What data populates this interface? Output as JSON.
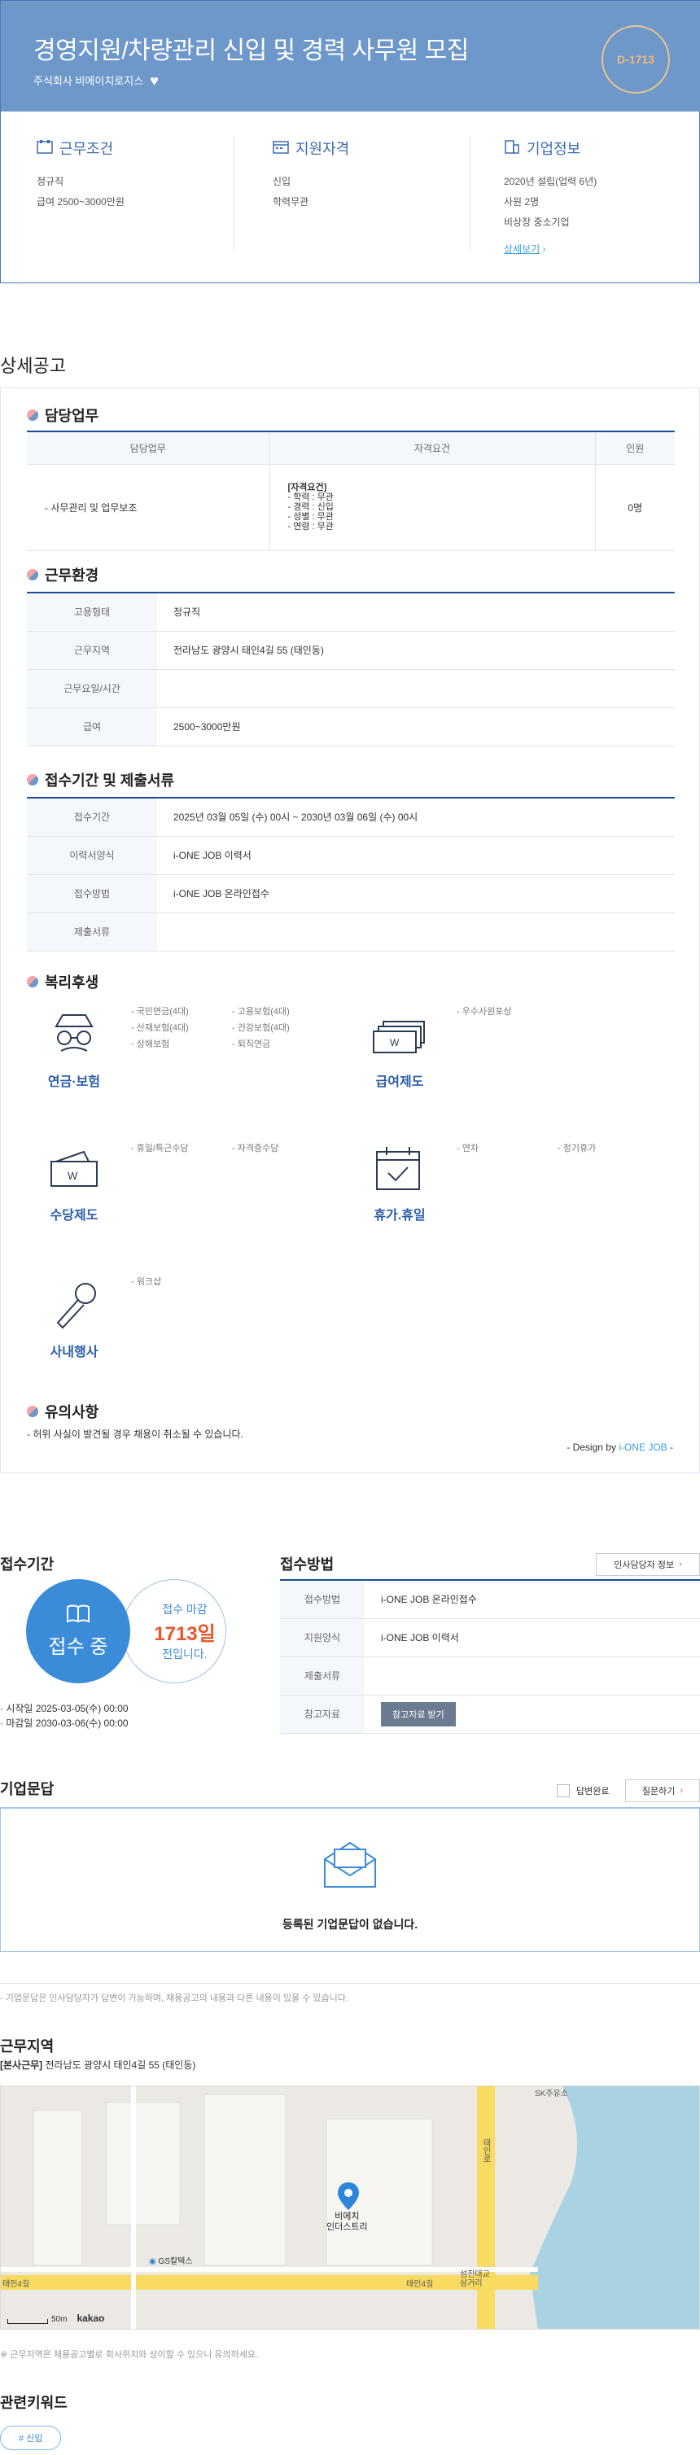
{
  "header": {
    "title": "경영지원/차량관리 신입 및 경력 사무원 모집",
    "company": "주식회사 비에이치로지스",
    "dday": "D-1713"
  },
  "summary": {
    "work": {
      "title": "근무조건",
      "type": "정규직",
      "salary": "급여 2500~3000만원"
    },
    "qual": {
      "title": "지원자격",
      "career": "신입",
      "education": "학력무관"
    },
    "company": {
      "title": "기업정보",
      "founded": "2020년 설립(업력 6년)",
      "employees": "사원 2명",
      "kind": "비상장 중소기업",
      "more": "상세보기"
    }
  },
  "detail": {
    "section_title": "상세공고",
    "duty": {
      "title": "담당업무",
      "headers": [
        "담당업무",
        "자격요건",
        "인원"
      ],
      "task": "- 사무관리 및 업무보조",
      "req_title": "[자격요건]",
      "req_lines": [
        "- 학력 : 무관",
        "- 경력 : 신입",
        "- 성별 : 무관",
        "- 연령 : 무관"
      ],
      "count": "0명"
    },
    "env": {
      "title": "근무환경",
      "rows": [
        {
          "k": "고용형태",
          "v": "정규직"
        },
        {
          "k": "근무지역",
          "v": "전라남도 광양시 태인4길 55 (태인동)"
        },
        {
          "k": "근무요일/시간",
          "v": ""
        },
        {
          "k": "급여",
          "v": "2500~3000만원"
        }
      ]
    },
    "apply": {
      "title": "접수기간 및 제출서류",
      "rows": [
        {
          "k": "접수기간",
          "v": "2025년 03월 05일 (수) 00시 ~ 2030년 03월 06일 (수) 00시"
        },
        {
          "k": "이력서양식",
          "v": "i-ONE JOB 이력서"
        },
        {
          "k": "접수방법",
          "v": "i-ONE JOB 온라인접수"
        },
        {
          "k": "제출서류",
          "v": ""
        }
      ]
    },
    "welfare": {
      "title": "복리후생",
      "groups": [
        {
          "label": "연금·보험",
          "items_a": [
            "- 국민연금(4대)",
            "- 산재보험(4대)",
            "- 상해보험"
          ],
          "items_b": [
            "- 고용보험(4대)",
            "- 건강보험(4대)",
            "- 퇴직연금"
          ]
        },
        {
          "label": "급여제도",
          "items_a": [
            "- 우수사원포상"
          ],
          "items_b": []
        },
        {
          "label": "수당제도",
          "items_a": [
            "- 휴일/특근수당"
          ],
          "items_b": [
            "- 자격증수당"
          ]
        },
        {
          "label": "휴가.휴일",
          "items_a": [
            "- 연차"
          ],
          "items_b": [
            "- 정기휴가"
          ]
        },
        {
          "label": "사내행사",
          "items_a": [
            "- 워크샵"
          ],
          "items_b": []
        }
      ]
    },
    "notice": {
      "title": "유의사항",
      "text": "- 허위 사실이 발견될 경우 채용이 취소될 수 있습니다.",
      "design_prefix": "- Design by",
      "design_brand": "i-ONE JOB",
      "design_suffix": " -"
    }
  },
  "period": {
    "title": "접수기간",
    "status": "접수 중",
    "deadline_label": "접수 마감",
    "deadline_days": "1713일",
    "deadline_suffix": "전입니다.",
    "start": "시작일 2025-03-05(수) 00:00",
    "end": "마감일 2030-03-06(수) 00:00"
  },
  "method": {
    "title": "접수방법",
    "contact_button": "인사담당자 정보",
    "rows": [
      {
        "k": "접수방법",
        "v": "i-ONE JOB 온라인접수"
      },
      {
        "k": "지원양식",
        "v": "i-ONE JOB 이력서"
      },
      {
        "k": "제출서류",
        "v": ""
      },
      {
        "k": "참고자료",
        "v": ""
      }
    ],
    "ref_button": "참고자료 받기"
  },
  "qna": {
    "title": "기업문답",
    "answered_label": "답변완료",
    "ask_button": "질문하기",
    "empty": "등록된 기업문답이 없습니다.",
    "note": "- 기업문답은 인사담당자가 답변이 가능하며, 채용공고의 내용과 다른 내용이 있을 수 있습니다."
  },
  "location": {
    "title": "근무지역",
    "tag": "[본사근무]",
    "address": "전라남도 광양시 태인4길 55 (태인동)",
    "map_marker": "비에치\n인더스트리",
    "map_labels": {
      "poi": "GS칼텍스",
      "road_left": "태인4길",
      "road_right": "태인4길",
      "junction": "섬진대교\n삼거리",
      "top": "SK주유소",
      "vertical_road": "태인로",
      "scale": "50m",
      "brand": "kakao"
    },
    "note": "※ 근무지역은 채용공고별로 회사위치와 상이할 수 있으니 유의하세요."
  },
  "keywords": {
    "title": "관련키워드",
    "items": [
      "# 신입"
    ]
  },
  "colors": {
    "primary": "#1b4d96",
    "banner": "#6e98c9",
    "accent": "#3b8cd8",
    "deadline": "#e8562a"
  }
}
